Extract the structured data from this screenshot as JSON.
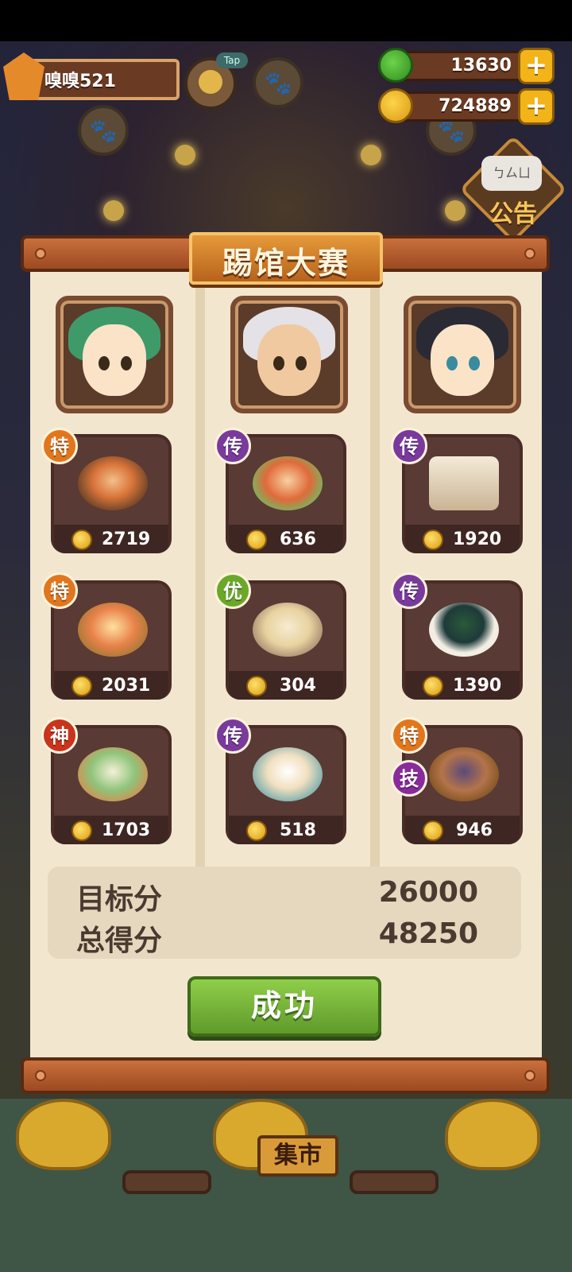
{
  "player": {
    "name": "嗅嗅521",
    "tap_label": "Tap"
  },
  "resources": {
    "apples": "13630",
    "coins": "724889",
    "plus_label": "+"
  },
  "notice": {
    "bubble_text": "ㄅㄙㄩ",
    "label": "公告"
  },
  "contest": {
    "title": "踢馆大赛",
    "portraits": [
      {
        "name": "green-haired-chef",
        "hair_color": "#3f9a6a"
      },
      {
        "name": "white-haired-chef",
        "hair_color": "#e4e2e6"
      },
      {
        "name": "dark-haired-chef",
        "hair_color": "#2a2a34"
      }
    ],
    "dishes": [
      [
        {
          "rank": "特",
          "rank_color": "#e2761c",
          "value": "2719",
          "icon": "meat-platter-icon"
        },
        {
          "rank": "特",
          "rank_color": "#e2761c",
          "value": "2031",
          "icon": "fried-fish-tray-icon"
        },
        {
          "rank": "神",
          "rank_color": "#c8341c",
          "value": "1703",
          "icon": "dessert-platter-icon"
        }
      ],
      [
        {
          "rank": "传",
          "rank_color": "#7a3a9c",
          "value": "636",
          "icon": "layered-cake-icon"
        },
        {
          "rank": "优",
          "rank_color": "#6aa82a",
          "value": "304",
          "icon": "noodle-bowl-icon"
        },
        {
          "rank": "传",
          "rank_color": "#7a3a9c",
          "value": "518",
          "icon": "tofu-plate-icon"
        }
      ],
      [
        {
          "rank": "传",
          "rank_color": "#7a3a9c",
          "value": "1920",
          "icon": "snack-pack-icon"
        },
        {
          "rank": "传",
          "rank_color": "#7a3a9c",
          "value": "1390",
          "icon": "green-dumpling-bowl-icon"
        },
        {
          "rank": "特",
          "rank_color": "#e2761c",
          "value": "946",
          "icon": "roll-cake-tray-icon",
          "extra_badge": "技",
          "extra_color": "#8a2a9c"
        }
      ]
    ],
    "target_label": "目标分",
    "target_score": "26000",
    "total_label": "总得分",
    "total_score": "48250",
    "result_button": "成功"
  },
  "market": {
    "label": "集市"
  }
}
